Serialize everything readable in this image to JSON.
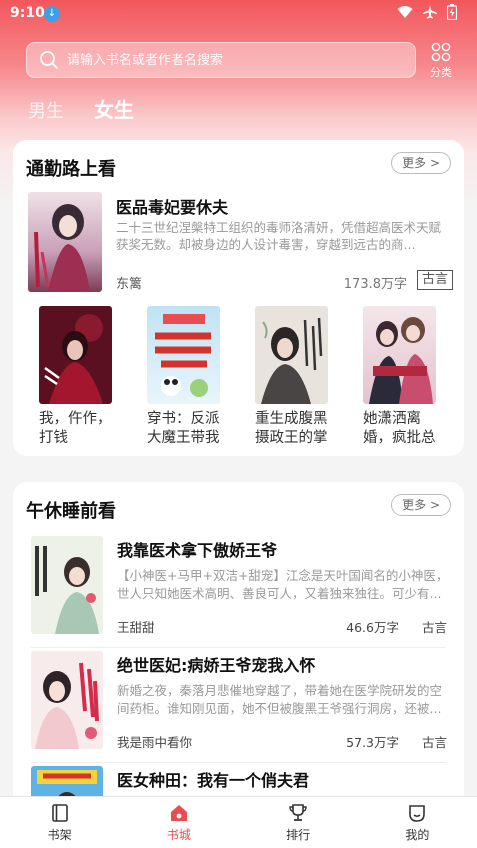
{
  "status_bar": {
    "time": "9:10",
    "download_icon": "download-arrow-icon"
  },
  "search": {
    "placeholder": "请输入书名或者作者名搜索",
    "category_label": "分类"
  },
  "gender_tabs": [
    {
      "label": "男生"
    },
    {
      "label": "女生",
      "active": true
    }
  ],
  "section_commute": {
    "title": "通勤路上看",
    "more": "更多 >",
    "featured": {
      "title": "医品毒妃要休夫",
      "description": "二十三世纪涅槃特工组织的毒师洛清妍，凭借超高医术天赋获奖无数。却被身边的人设计毒害，穿越到远古的商...",
      "author": "东篱",
      "words": "173.8万字",
      "tag": "古言"
    },
    "grid": [
      {
        "title": "我，仵作，打钱"
      },
      {
        "title": "穿书：反派大魔王带我兴..."
      },
      {
        "title": "重生成腹黑摄政王的掌中娇"
      },
      {
        "title": "她潇洒离婚，疯批总裁悔..."
      }
    ]
  },
  "section_nap": {
    "title": "午休睡前看",
    "more": "更多 >",
    "list": [
      {
        "title": "我靠医术拿下傲娇王爷",
        "description": "【小神医+马甲+双洁+甜宠】江念是天叶国闻名的小神医，世人只知她医术高明、善良可人，又着独来独往。可少有...",
        "author": "王甜甜",
        "words": "46.6万字",
        "tag": "古言"
      },
      {
        "title": "绝世医妃:病娇王爷宠我入怀",
        "description": "新婚之夜，秦落月悲催地穿越了，带着她在医学院研发的空间药柜。谁知刚见面，她不但被腹黑王爷强行洞房，还被...",
        "author": "我是雨中看你",
        "words": "57.3万字",
        "tag": "古言"
      },
      {
        "title": "医女种田：我有一个俏夫君"
      }
    ]
  },
  "bottom_nav": [
    {
      "label": "书架",
      "icon": "bookshelf-icon"
    },
    {
      "label": "书城",
      "icon": "bookstore-home-icon",
      "active": true
    },
    {
      "label": "排行",
      "icon": "trophy-icon"
    },
    {
      "label": "我的",
      "icon": "profile-face-icon"
    }
  ]
}
